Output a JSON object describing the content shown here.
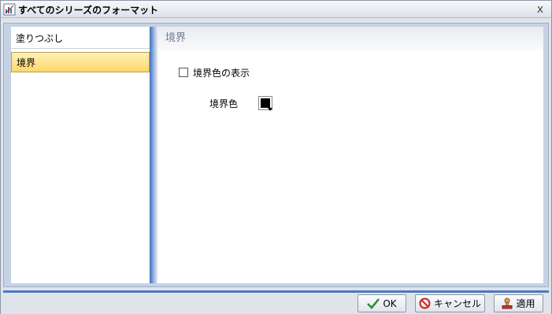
{
  "window": {
    "title": "すべてのシリーズのフォーマット",
    "close_label": "x"
  },
  "sidebar": {
    "items": [
      {
        "label": "塗りつぶし",
        "selected": false
      },
      {
        "label": "境界",
        "selected": true
      }
    ]
  },
  "main": {
    "section_title": "境界",
    "show_border_color": {
      "label": "境界色の表示",
      "checked": false
    },
    "border_color": {
      "label": "境界色",
      "value": "#000000"
    }
  },
  "footer": {
    "ok_label": "OK",
    "cancel_label": "キャンセル",
    "apply_label": "適用"
  },
  "colors": {
    "selection_gradient_top": "#fff1b8",
    "selection_gradient_bottom": "#ffd86a",
    "accent_blue": "#4c79c0",
    "section_text": "#6b7b93"
  }
}
